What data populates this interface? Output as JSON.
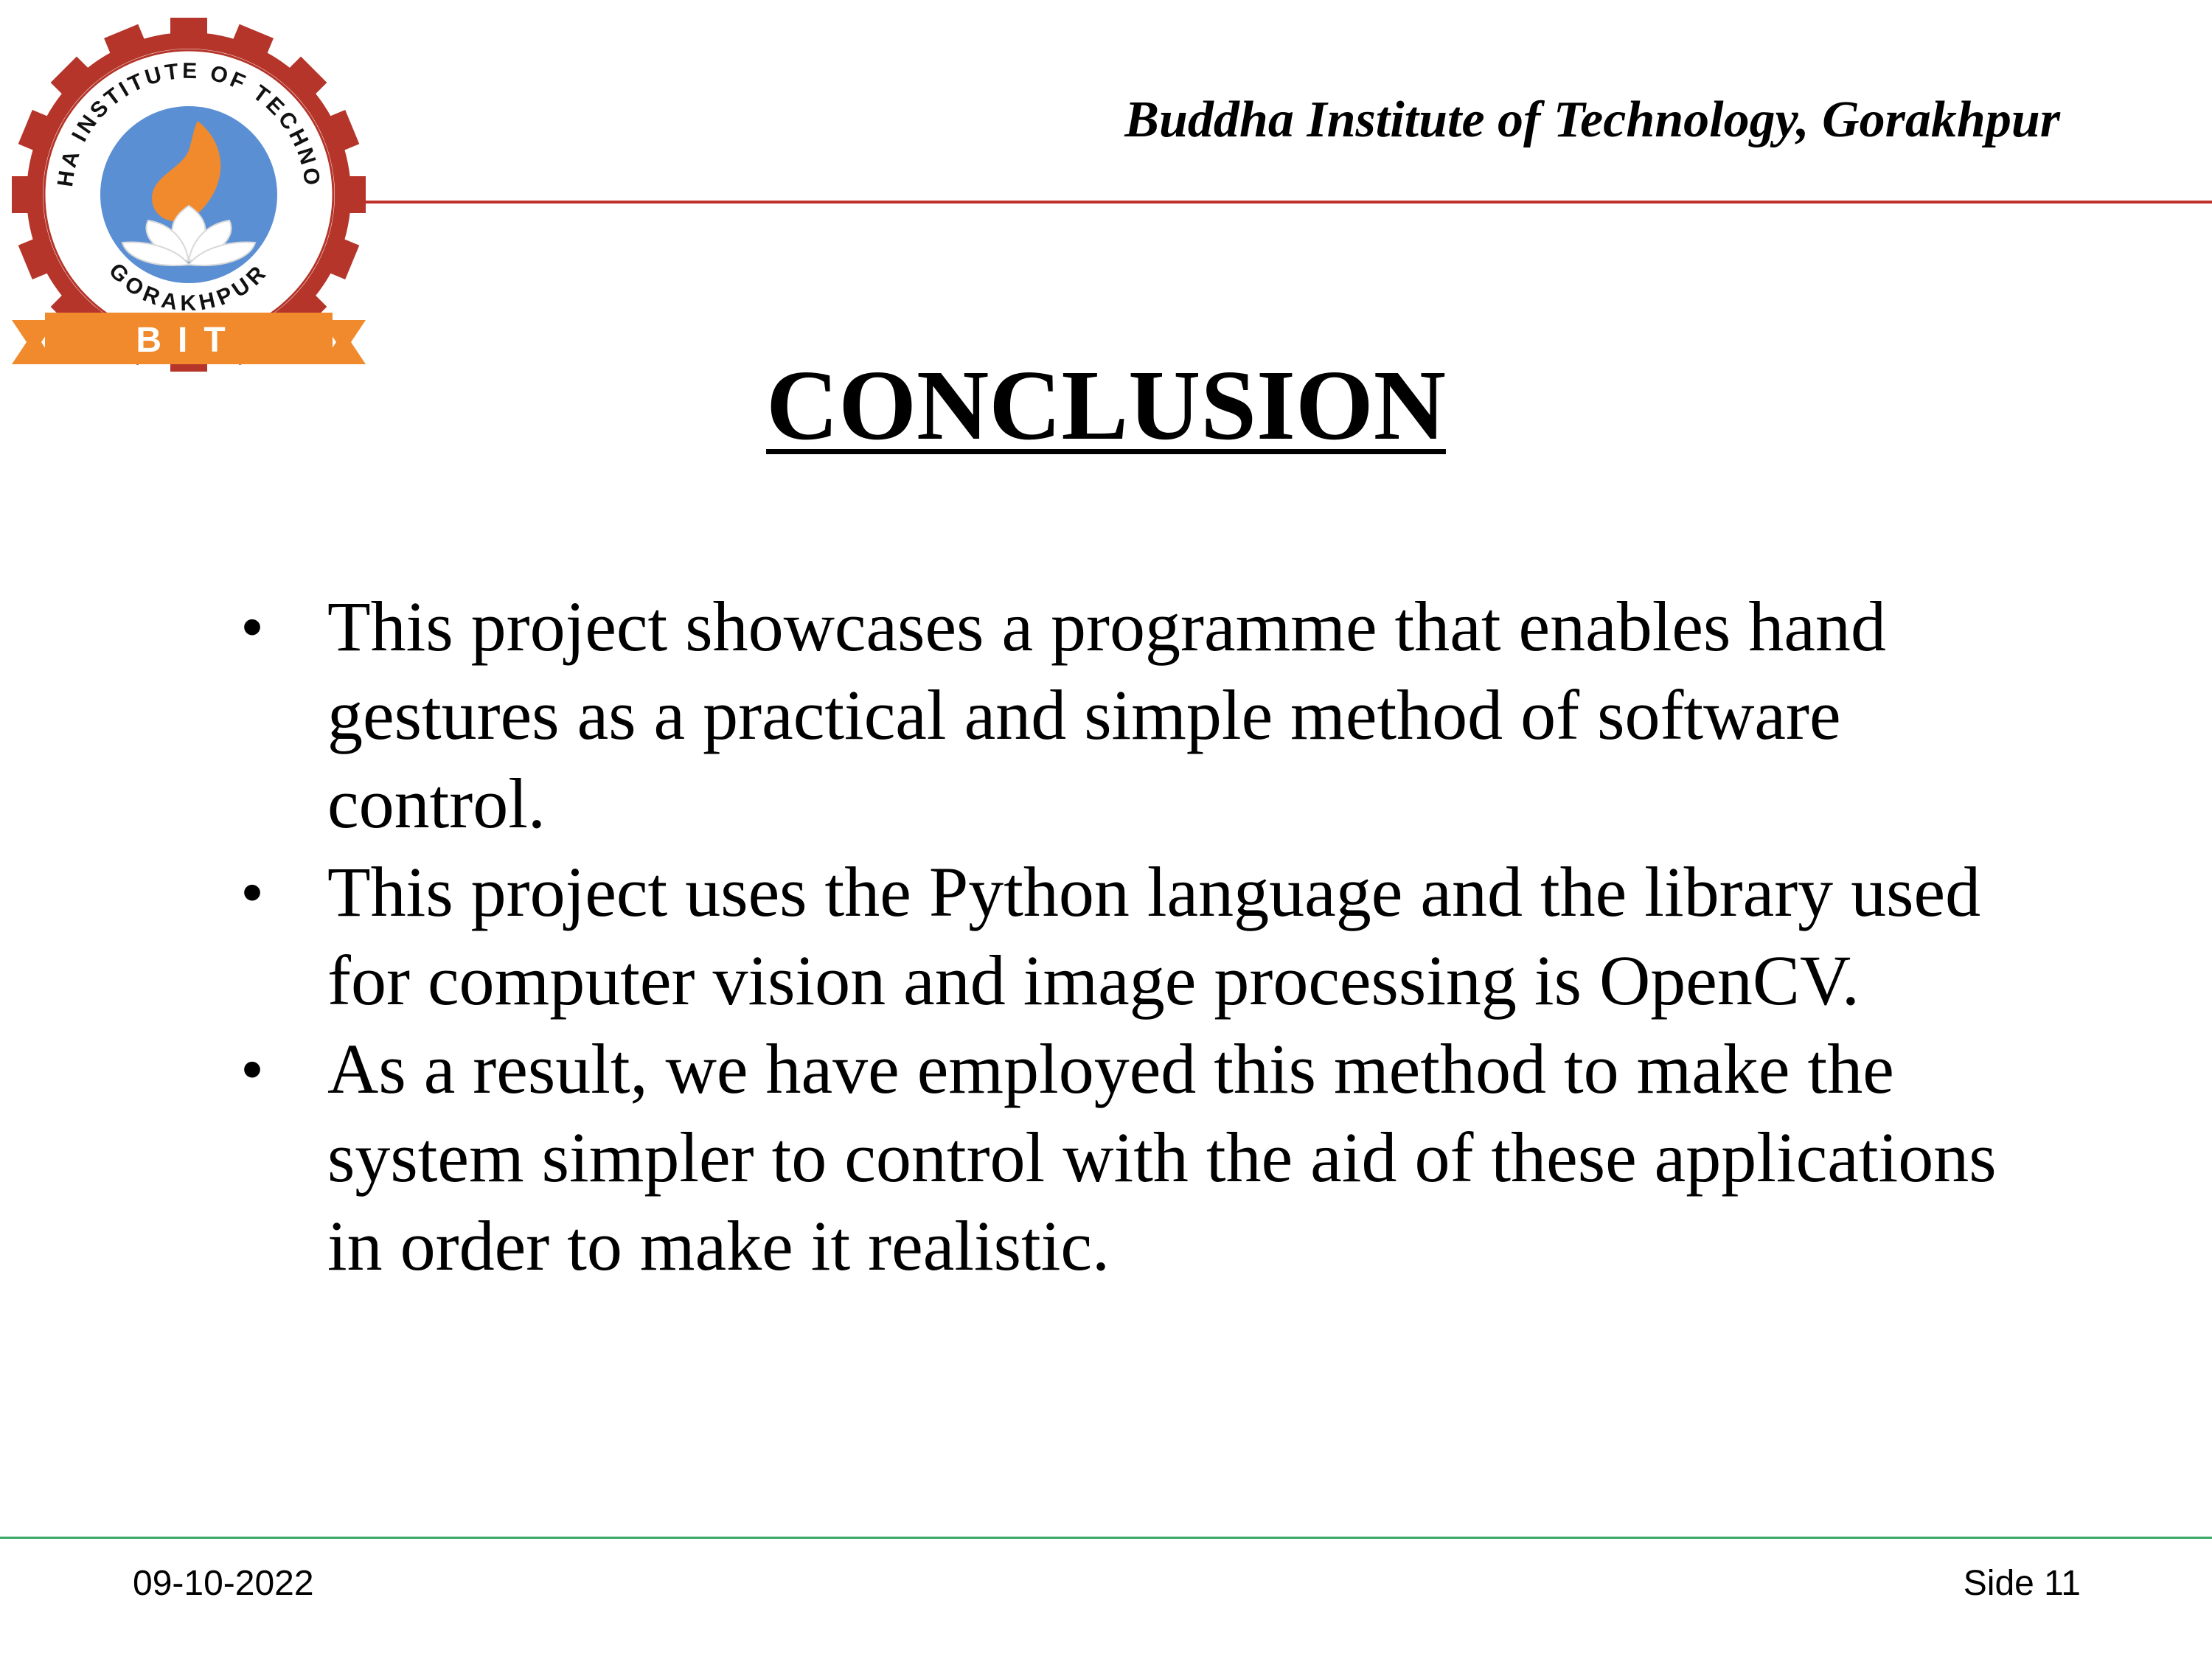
{
  "header": {
    "institute": "Buddha Institute of Technology, Gorakhpur",
    "rule_color": "#c0302a"
  },
  "logo": {
    "icon": "bit-gear-lotus-logo",
    "ring_text": "BUDDHA INSTITUTE OF TECHNOLOGY",
    "city_text": "GORAKHPUR",
    "banner_text": "BIT",
    "ring_color": "#b5352a",
    "disc_color": "#5b8fd4",
    "banner_color": "#f08a2c"
  },
  "slide": {
    "title": "CONCLUSION",
    "bullets": [
      "This project showcases a programme that enables hand gestures as a practical and simple method of software control.",
      "This project uses the Python language and the library used for computer vision and image processing is OpenCV.",
      "As a result, we have employed this method to make the system simpler to control with the aid of these applications in order to make it realistic."
    ],
    "bullet_glyph": "•"
  },
  "footer": {
    "date": "09-10-2022",
    "page": "Side 11",
    "rule_color": "#3aa866"
  }
}
